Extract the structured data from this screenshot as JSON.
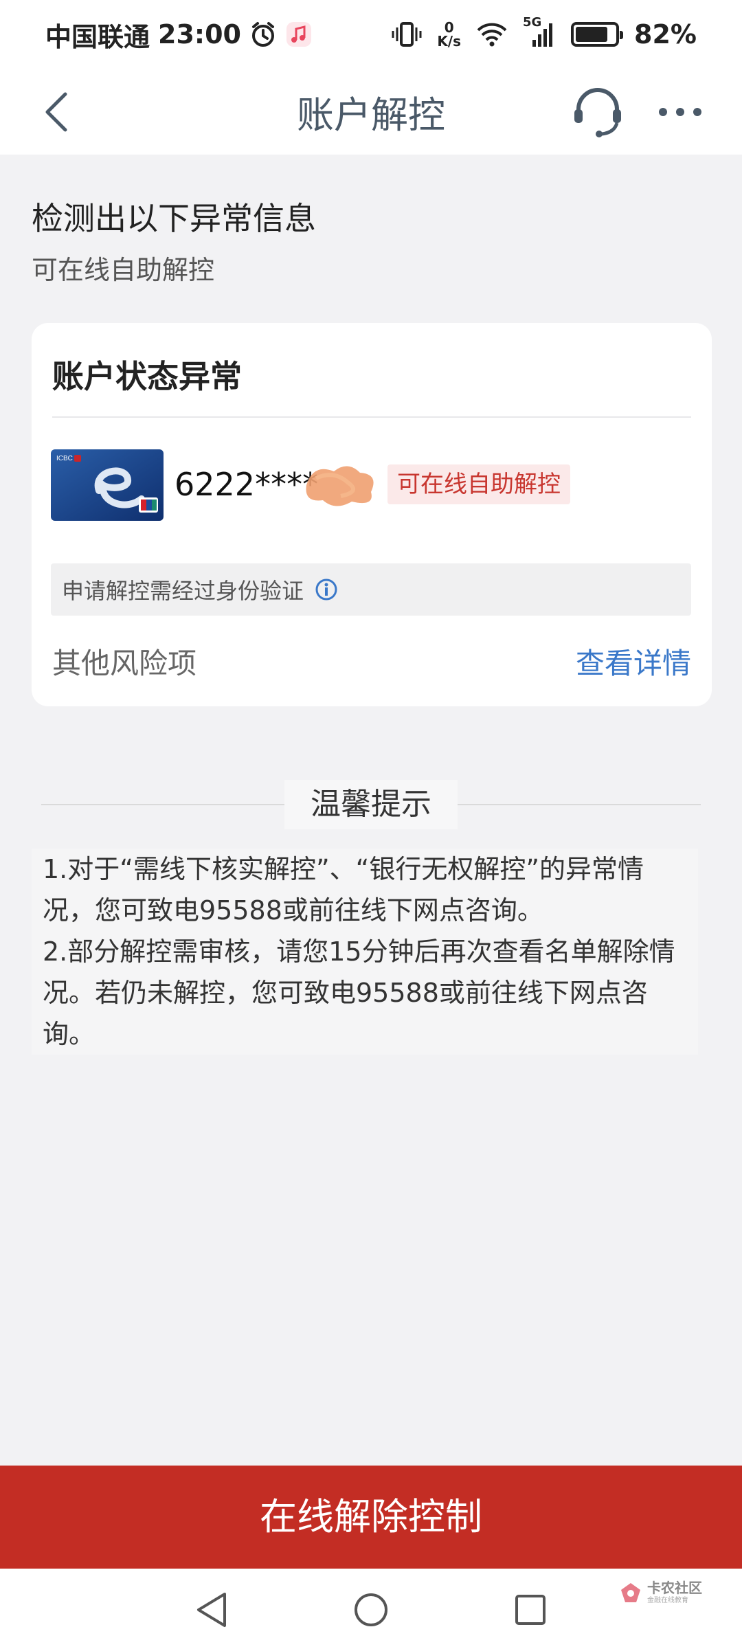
{
  "status_bar": {
    "carrier": "中国联通",
    "time": "23:00",
    "net_speed_value": "0",
    "net_speed_unit": "K/s",
    "network_type": "5G",
    "battery_percent": "82%",
    "battery_level": 0.82
  },
  "nav": {
    "title": "账户解控"
  },
  "header": {
    "title": "检测出以下异常信息",
    "subtitle": "可在线自助解控"
  },
  "account_card": {
    "title": "账户状态异常",
    "card_number": "6222****",
    "status_tag": "可在线自助解控",
    "verify_note": "申请解控需经过身份验证",
    "other_risk_label": "其他风险项",
    "detail_link": "查看详情",
    "card_brand": "ICBC"
  },
  "tips": {
    "title": "温馨提示",
    "items": [
      "1.对于“需线下核实解控”、“银行无权解控”的异常情况，您可致电95588或前往线下网点咨询。",
      "2.部分解控需审核，请您15分钟后再次查看名单解除情况。若仍未解控，您可致电95588或前往线下网点咨询。"
    ]
  },
  "action": {
    "button_label": "在线解除控制"
  },
  "watermark": {
    "main": "卡农社区",
    "sub": "金融在线教育"
  },
  "colors": {
    "accent_red": "#c32d24",
    "link_blue": "#3a78c9",
    "tag_bg": "#fbe9e9"
  },
  "icons": [
    "alarm-icon",
    "music-icon",
    "vibrate-icon",
    "wifi-icon",
    "signal-icon",
    "battery-icon",
    "back-icon",
    "headset-icon",
    "more-icon",
    "info-icon",
    "nav-back-triangle-icon",
    "home-circle-icon",
    "recents-square-icon"
  ]
}
